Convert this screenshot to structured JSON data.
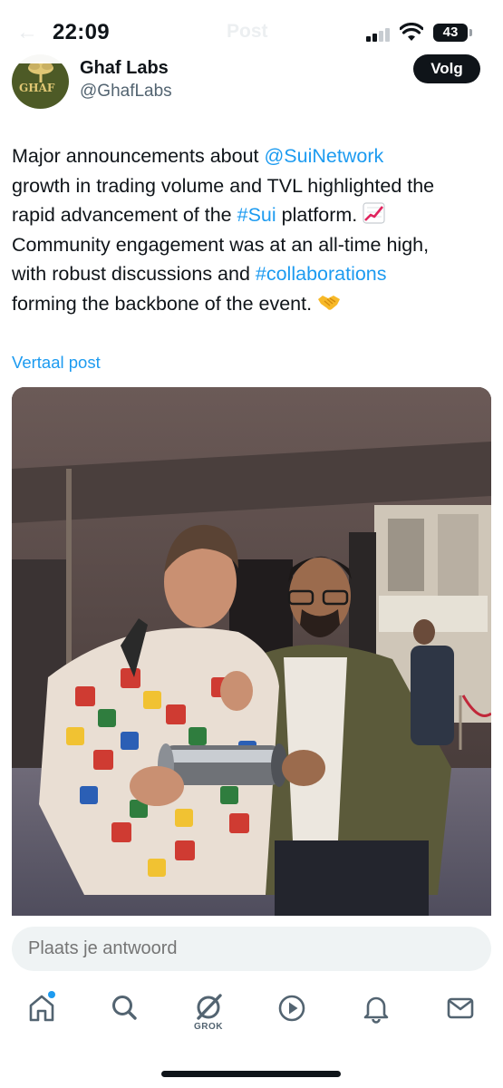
{
  "status_bar": {
    "time": "22:09",
    "battery_level": "43",
    "header_ghost_title": "Post",
    "icons": [
      "cellular-signal-icon",
      "wifi-icon",
      "battery-icon",
      "back-arrow-icon"
    ]
  },
  "author": {
    "name": "Ghaf Labs",
    "handle": "@GhafLabs",
    "avatar_text": "GHAF",
    "follow_label": "Volg"
  },
  "post": {
    "lines": [
      {
        "pre": "Major announcements about ",
        "link": "@SuiNetwork",
        "post": ""
      },
      {
        "pre": "growth in trading volume and TVL highlighted the",
        "link": "",
        "post": ""
      },
      {
        "pre": "rapid advancement of the ",
        "link": "#Sui",
        "post": " platform. ",
        "emoji": "chart-increasing-emoji"
      },
      {
        "pre": "Community engagement was at an all-time high,",
        "link": "",
        "post": ""
      },
      {
        "pre": "with robust discussions and ",
        "link": "#collaborations",
        "post": ""
      },
      {
        "pre": "forming the backbone of the event. ",
        "link": "",
        "post": "",
        "emoji": "handshake-emoji"
      }
    ],
    "translate_label": "Vertaal post"
  },
  "reply": {
    "placeholder": "Plaats je antwoord"
  },
  "nav": {
    "items": [
      "home",
      "search",
      "grok",
      "media",
      "notifications",
      "messages"
    ],
    "grok_label": "GROK"
  },
  "colors": {
    "link": "#1d9bf0",
    "text": "#0f1419",
    "secondary": "#536471",
    "avatar_bg": "#4d5a26"
  }
}
